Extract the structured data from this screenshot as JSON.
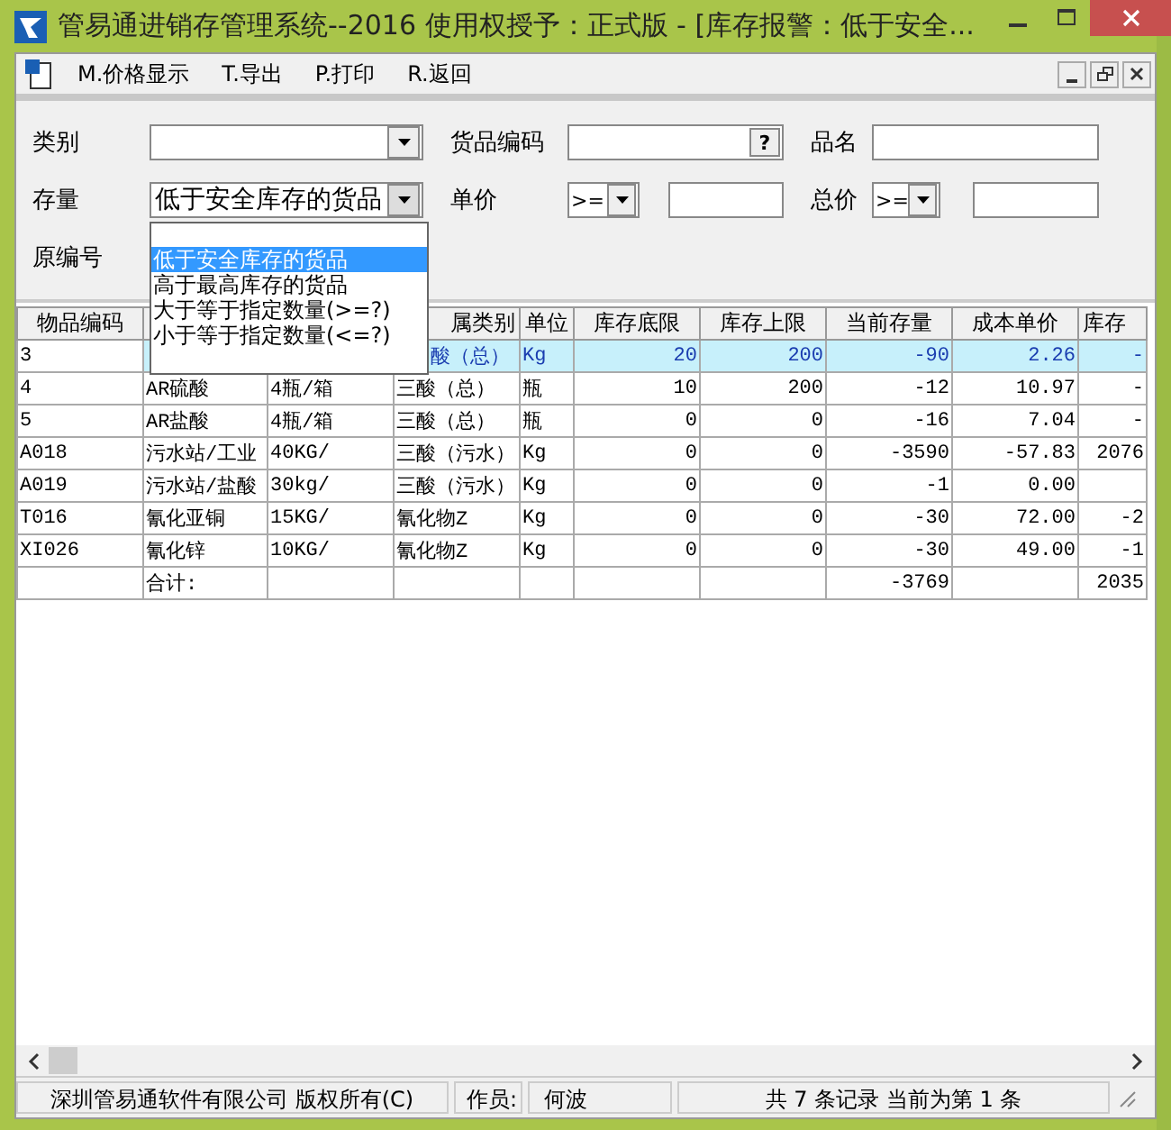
{
  "window": {
    "title": "管易通进销存管理系统--2016  使用权授予：正式版 - [库存报警：低于安全..."
  },
  "menu": [
    {
      "label": "M.价格显示"
    },
    {
      "label": "T.导出"
    },
    {
      "label": "P.打印"
    },
    {
      "label": "R.返回"
    }
  ],
  "filters": {
    "category": {
      "label": "类别"
    },
    "code": {
      "label": "货品编码",
      "lookup": "?"
    },
    "name": {
      "label": "品名"
    },
    "stock": {
      "label": "存量",
      "value": "低于安全库存的货品",
      "expanded": true,
      "options": [
        {
          "label": "低于安全库存的货品",
          "selected": true
        },
        {
          "label": "高于最高库存的货品",
          "selected": false
        },
        {
          "label": "大于等于指定数量(>=?)",
          "selected": false
        },
        {
          "label": "小于等于指定数量(<=?)",
          "selected": false
        }
      ]
    },
    "unit_price": {
      "label": "单价",
      "operator": ">="
    },
    "total_price": {
      "label": "总价",
      "operator": ">="
    },
    "original_code": {
      "label": "原编号"
    }
  },
  "table": {
    "columns": [
      {
        "label": "物品编码"
      },
      {},
      {},
      {
        "label": "属类别"
      },
      {
        "label": "单位"
      },
      {
        "label": "库存底限"
      },
      {
        "label": "库存上限"
      },
      {
        "label": "当前存量"
      },
      {
        "label": "成本单价"
      },
      {
        "label": "库存"
      }
    ],
    "rows": [
      {
        "selected": true,
        "cells": [
          "3",
          null,
          null,
          "酸（总）",
          "Kg",
          "20",
          "200",
          "-90",
          "2.26",
          "-"
        ]
      },
      {
        "selected": false,
        "cells": [
          "4",
          "AR硫酸",
          "4瓶/箱",
          "三酸（总）",
          "瓶",
          "10",
          "200",
          "-12",
          "10.97",
          "-"
        ]
      },
      {
        "selected": false,
        "cells": [
          "5",
          "AR盐酸",
          "4瓶/箱",
          "三酸（总）",
          "瓶",
          "0",
          "0",
          "-16",
          "7.04",
          "-"
        ]
      },
      {
        "selected": false,
        "cells": [
          "A018",
          "污水站/工业",
          "40KG/",
          "三酸（污水）",
          "Kg",
          "0",
          "0",
          "-3590",
          "-57.83",
          "2076"
        ]
      },
      {
        "selected": false,
        "cells": [
          "A019",
          "污水站/盐酸",
          "30kg/",
          "三酸（污水）",
          "Kg",
          "0",
          "0",
          "-1",
          "0.00",
          null
        ]
      },
      {
        "selected": false,
        "cells": [
          "T016",
          "氰化亚铜",
          "15KG/",
          "氰化物Z",
          "Kg",
          "0",
          "0",
          "-30",
          "72.00",
          "-2"
        ]
      },
      {
        "selected": false,
        "cells": [
          "XI026",
          "氰化锌",
          "10KG/",
          "氰化物Z",
          "Kg",
          "0",
          "0",
          "-30",
          "49.00",
          "-1"
        ]
      },
      {
        "selected": false,
        "cells": [
          null,
          "合计:",
          null,
          null,
          null,
          null,
          null,
          "-3769",
          null,
          "2035"
        ]
      }
    ]
  },
  "status_bar": [
    "深圳管易通软件有限公司 版权所有(C)",
    "作员:",
    "何波",
    "共 7 条记录 当前为第 1 条"
  ]
}
